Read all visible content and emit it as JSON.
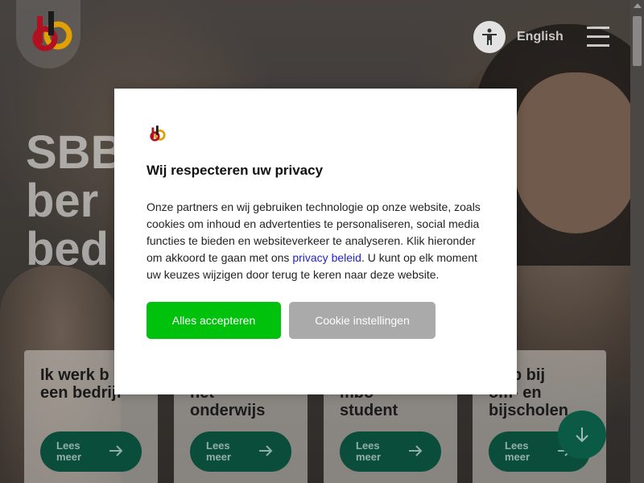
{
  "header": {
    "language_link": "English",
    "accessibility_label": "accessibility",
    "menu_label": "menu"
  },
  "hero": {
    "title_lines": [
      "SBB",
      "ber",
      "bed"
    ]
  },
  "cards": [
    {
      "title_l1": "Ik werk b",
      "title_l2": "een bedrijf",
      "button": {
        "line1": "Lees",
        "line2": "meer"
      }
    },
    {
      "title_l1": "",
      "title_l2": "het onderwijs",
      "button": {
        "line1": "Lees",
        "line2": "meer"
      }
    },
    {
      "title_l1": "mbo-",
      "title_l2": "student",
      "button": {
        "line1": "Lees",
        "line2": "meer"
      }
    },
    {
      "title_l1": "help bij",
      "title_l2": "om- en bijscholen",
      "button": {
        "line1": "Lees",
        "line2": "meer"
      }
    }
  ],
  "modal": {
    "title": "Wij respecteren uw privacy",
    "text_before_link": "Onze partners en wij gebruiken technologie op onze website, zoals cookies om inhoud en advertenties te personaliseren, social media functies te bieden en websiteverkeer te analyseren. Klik hieronder om akkoord te gaan met ons ",
    "link_text": "privacy beleid",
    "text_after_link": ". U kunt op elk moment uw keuzes wijzigen door terug te keren naar deze website.",
    "accept_button": "Alles accepteren",
    "settings_button": "Cookie instellingen"
  },
  "colors": {
    "accept": "#00c10b",
    "settings": "#aaaaaa",
    "card_button": "#0b4d3b",
    "link": "#2222cc"
  },
  "icons": [
    "accessibility-icon",
    "hamburger-icon",
    "arrow-right-icon",
    "arrow-down-icon",
    "sbb-logo"
  ]
}
